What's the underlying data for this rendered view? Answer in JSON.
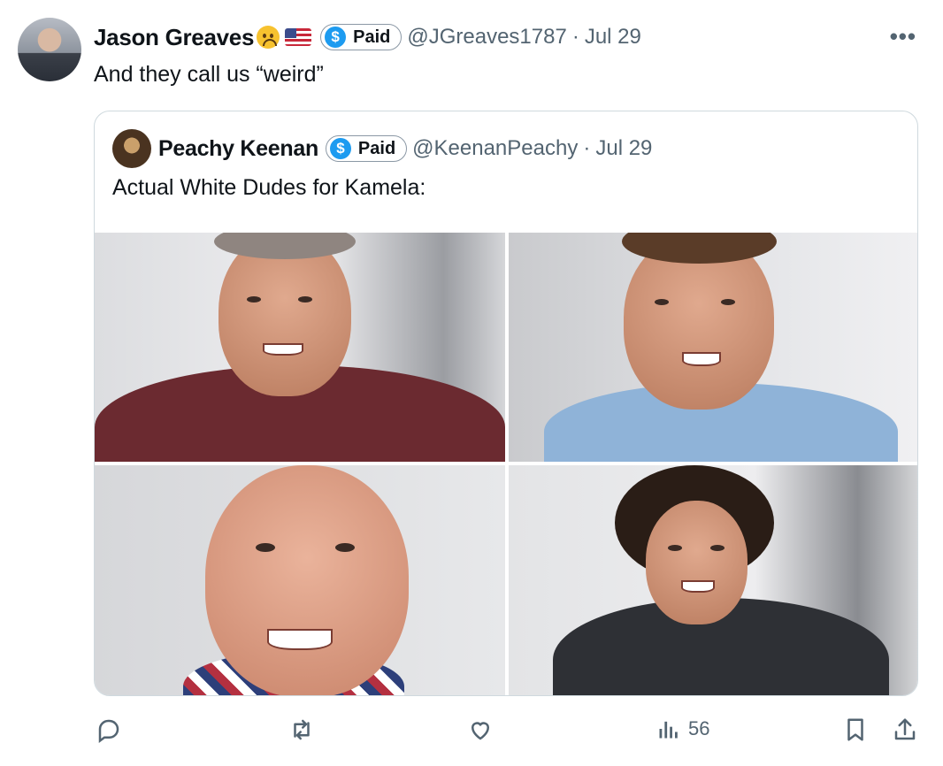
{
  "author": {
    "name": "Jason Greaves",
    "emoji": "upside-down-face",
    "flag": "us-flag",
    "paid_label": "Paid",
    "handle": "@JGreaves1787",
    "date": "Jul 29",
    "separator": "·"
  },
  "more_label": "•••",
  "tweet_text": "And they call us “weird”",
  "quoted": {
    "name": "Peachy Keenan",
    "paid_label": "Paid",
    "handle": "@KeenanPeachy",
    "date": "Jul 29",
    "separator": "·",
    "text": "Actual White Dudes for Kamela:",
    "photos": [
      "photo-man-maroon-shirt",
      "photo-man-blue-shirt",
      "photo-bald-man-smiling",
      "photo-curly-hair-man"
    ]
  },
  "actions": {
    "views": "56",
    "icons": [
      "reply-icon",
      "repost-icon",
      "like-icon",
      "views-icon",
      "bookmark-icon",
      "share-icon"
    ]
  },
  "colors": {
    "accent": "#1d9bf0",
    "muted": "#536471",
    "text": "#0f1419",
    "border": "#cfd9de"
  }
}
